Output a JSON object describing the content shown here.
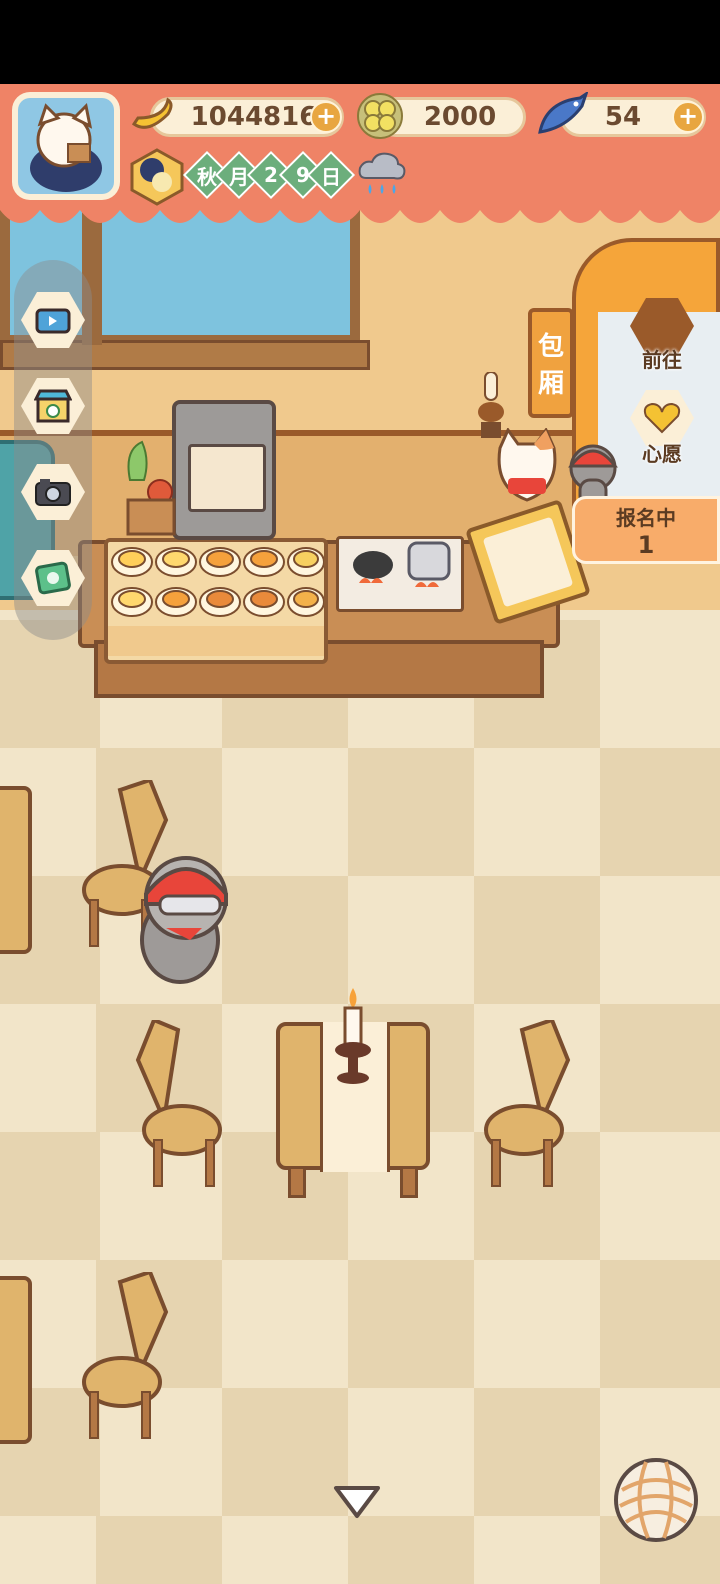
{
  "hud": {
    "currencies": [
      {
        "name": "banana-coins",
        "value": "1044816"
      },
      {
        "name": "clover",
        "value": "2000"
      },
      {
        "name": "fish",
        "value": "54"
      }
    ],
    "date": {
      "season": "秋",
      "month_label": "月",
      "day_digits": [
        "2",
        "9"
      ],
      "day_label": "日"
    },
    "weather": "rainy"
  },
  "room": {
    "private_room_sign": [
      "包",
      "厢"
    ],
    "go_button": "前往",
    "wish_button": "心愿",
    "registration": {
      "label": "报名中",
      "count": "1"
    }
  },
  "side_menu": [
    "tv-icon",
    "shop-icon",
    "camera-icon",
    "ticket-icon"
  ],
  "colors": {
    "hud": "#ef8366",
    "floor_light": "#f2e5c9",
    "floor_dark": "#e6d4b0",
    "wood": "#e0b46c"
  }
}
